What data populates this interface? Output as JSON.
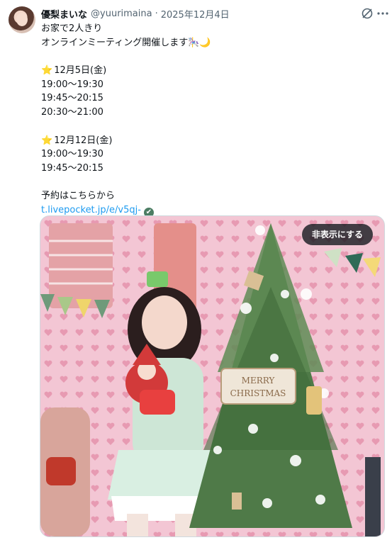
{
  "author": {
    "name": "優梨まいな",
    "handle": "@yuurimaina",
    "separator": "·",
    "date": "2025年12月4日"
  },
  "tweet": {
    "line1": "お家で2人きり",
    "line2": "オンラインミーティング開催します🎠🌙",
    "schedule1": {
      "title": "12月5日(金)",
      "slots": [
        "19:00〜19:30",
        "19:45〜20:15",
        "20:30〜21:00"
      ]
    },
    "schedule2": {
      "title": "12月12日(金)",
      "slots": [
        "19:00〜19:30",
        "19:45〜20:15"
      ]
    },
    "reserve_text": "予約はこちらから",
    "link_text": "t.livepocket.jp/e/v5qj-"
  },
  "media": {
    "hide_button_label": "非表示にする",
    "sign_line1": "MERRY",
    "sign_line2": "CHRISTMAS"
  },
  "icons": {
    "star": "⭐",
    "verified": "✔"
  },
  "colors": {
    "link": "#1d9bf0",
    "secondary_text": "#536471",
    "wall_pink": "#f2c9d6",
    "tree_green": "#3f6b3a"
  }
}
